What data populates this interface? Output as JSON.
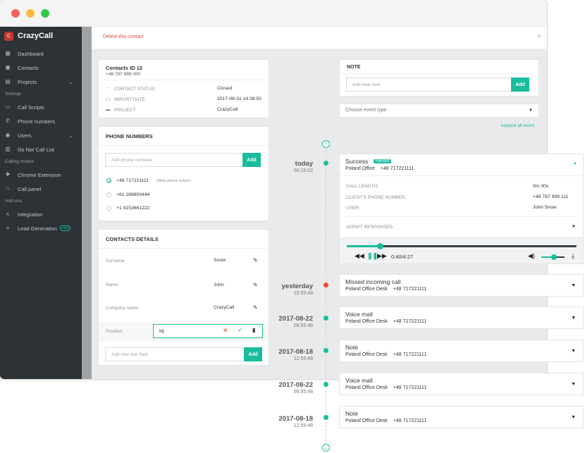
{
  "sidebar": {
    "brand": "CrazyCall",
    "items": [
      {
        "label": "Dashboard",
        "icon": "dashboard-icon"
      },
      {
        "label": "Contacts",
        "icon": "contacts-icon"
      },
      {
        "label": "Projects",
        "icon": "projects-icon"
      }
    ],
    "section_settings": "Settings",
    "settings_items": [
      {
        "label": "Call Scripts"
      },
      {
        "label": "Phone numbers"
      },
      {
        "label": "Users"
      },
      {
        "label": "Do Not Call List"
      }
    ],
    "section_calling": "Calling modes",
    "calling_items": [
      {
        "label": "Chrome Extension"
      },
      {
        "label": "Call panel"
      }
    ],
    "section_addons": "Add-ons",
    "addon_items": [
      {
        "label": "Integration"
      },
      {
        "label": "Lead Generation"
      }
    ],
    "lead_badge": "new"
  },
  "topbar": {
    "delete_label": "Delete this contact",
    "close": "×"
  },
  "contact": {
    "title": "Contacts ID 12",
    "phone": "+48 787 999 000",
    "status_label": "CONTACT STATUS:",
    "status_value": "Closed",
    "import_label": "IMPORT DATE:",
    "import_value": "2017-08-31 14:38:50",
    "project_label": "PROJECT:",
    "project_value": "CrazyCall"
  },
  "phone_numbers": {
    "title": "PHONE NUMBERS",
    "placeholder": "Add phone numbers",
    "add_label": "Add",
    "numbers": [
      {
        "number": "+48 717221111",
        "note": "(Main phone nuber)"
      },
      {
        "number": "+61 288800444",
        "note": ""
      },
      {
        "number": "+1 4153661222",
        "note": ""
      }
    ]
  },
  "details": {
    "title": "CONTACTS DETAILS",
    "surname_label": "Surname:",
    "surname_value": "Snow",
    "name_label": "Name:",
    "name_value": "John",
    "company_label": "Company name:",
    "company_value": "CrazyCall",
    "position_label": "Position:",
    "position_value": "Mj",
    "new_field_placeholder": "Add new text field",
    "add_label": "Add"
  },
  "note": {
    "title": "NOTE",
    "placeholder": "Add new note",
    "add_label": "Add",
    "event_type_placeholder": "Choose event type",
    "expand_label": "expand all event"
  },
  "timeline": [
    {
      "date": "today",
      "time": "00:15:02",
      "status": "success"
    },
    {
      "date": "yesterday",
      "time": "15:55:48",
      "status": "missed"
    },
    {
      "date": "2017-08-22",
      "time": "08:55:48",
      "status": "ok"
    },
    {
      "date": "2017-08-18",
      "time": "12:55:48",
      "status": "ok"
    },
    {
      "date": "2017-08-22",
      "time": "08:55:48",
      "status": "ok"
    },
    {
      "date": "2017-08-18",
      "time": "12:55:48",
      "status": "ok"
    }
  ],
  "events": [
    {
      "title": "Success",
      "badge": "Record",
      "office": "Poland Office",
      "number": "+48 717221111",
      "call_length_label": "CALL LENGTH:",
      "call_length_value": "0m 00s",
      "client_phone_label": "CLIENT'S PHONE NUMBER:",
      "client_phone_value": "+48 787  999 111",
      "user_label": "USER:",
      "user_value": "John Snow",
      "script_label": "SCRIPT RESPONSES:",
      "player_time": "0:40/4:27",
      "player_progress": 0.143,
      "volume_level": 0.55
    },
    {
      "title": "Missed incoming call",
      "office": "Poland Office Desk",
      "number": "+48 717221111"
    },
    {
      "title": "Voice mail",
      "office": "Poland Office Desk",
      "number": "+48 717221111"
    },
    {
      "title": "Note",
      "office": "Poland Office Desk",
      "number": "+48 717221111"
    },
    {
      "title": "Voice mail",
      "office": "Poland Office Desk",
      "number": "+48 717221111"
    },
    {
      "title": "Note",
      "office": "Poland Office Desk",
      "number": "+48 717221111"
    }
  ],
  "colors": {
    "accent": "#1abc9c",
    "danger": "#e74c3c",
    "sidebar": "#2d3237"
  }
}
